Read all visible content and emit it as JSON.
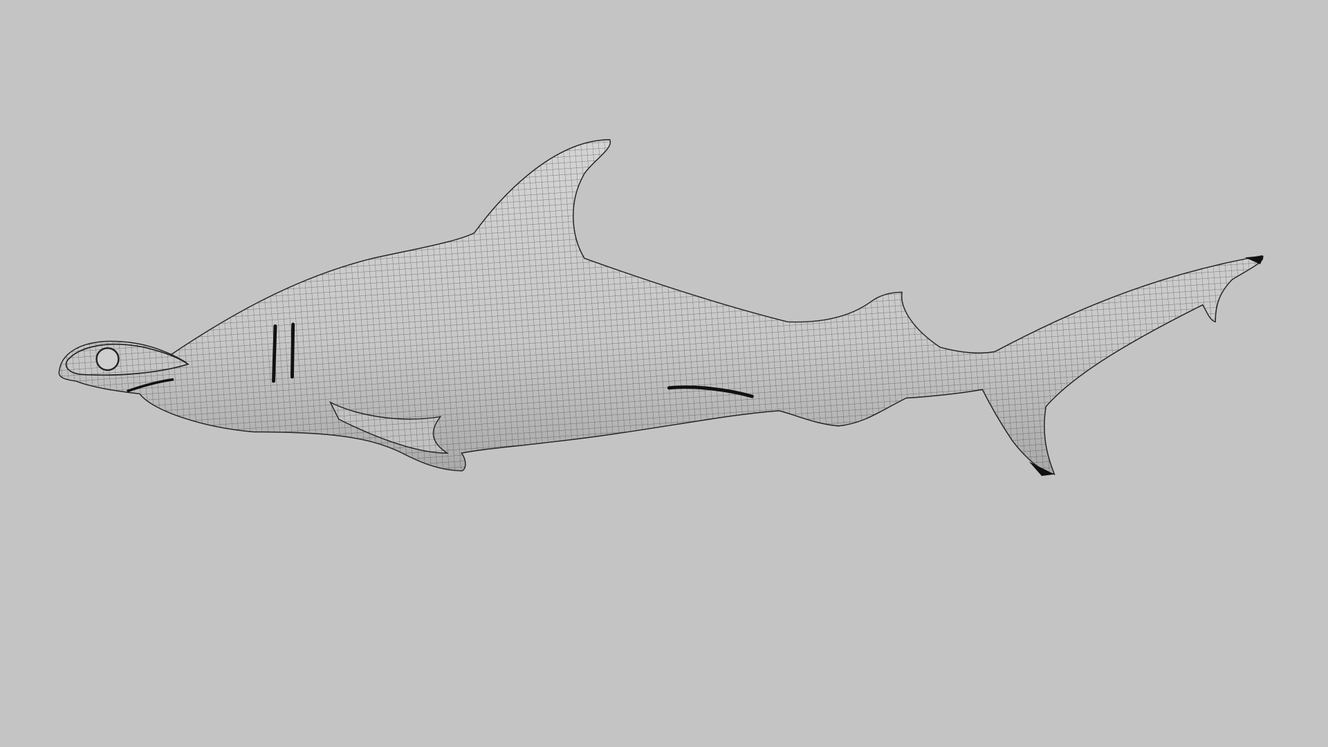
{
  "scene": {
    "subject": "hammerhead-shark-wireframe",
    "background_color": "#c4c4c4",
    "surface_color": "#c9c9c9",
    "wire_color": "#3a3a3a"
  }
}
